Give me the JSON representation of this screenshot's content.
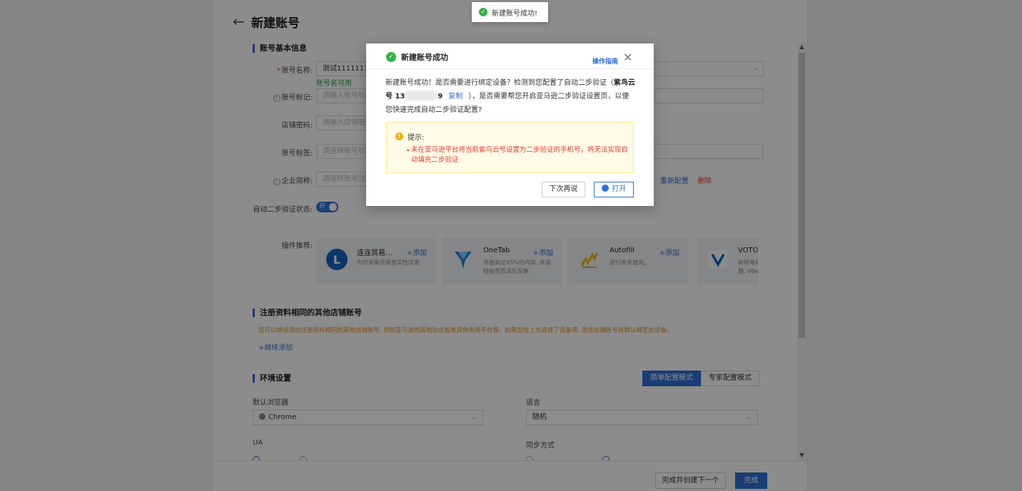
{
  "page": {
    "title": "新建账号",
    "sections": {
      "basic": "账号基本信息",
      "other_accounts": "注册资料相同的其他店铺账号",
      "env": "环境设置"
    },
    "form": {
      "account_name_label": "账号名称:",
      "account_name_value": "测试1111111",
      "account_name_hint": "账号名可用",
      "account_tag_label": "账号标记:",
      "account_tag_placeholder": "请输入账号标记",
      "shop_password_label": "店铺密码:",
      "shop_password_placeholder": "请输入店铺密码",
      "account_label_label": "账号标签:",
      "account_label_placeholder": "请选择账号标签",
      "enterprise_label": "企业简称:",
      "enterprise_placeholder": "请选择账号注册",
      "reconfig": "重新配置",
      "delete": "删除",
      "auto_2fa_label": "自动二步验证状态:",
      "auto_2fa_toggle": "开",
      "plugin_label": "插件推荐:"
    },
    "plugins": [
      {
        "name": "连连贸易...",
        "add": "+添加",
        "desc": "为您采集贸易真实性信息",
        "icon": "lianlian-icon"
      },
      {
        "name": "OneTab",
        "add": "+添加",
        "desc": "节省高达95%的内存, 并减轻标签页混乱现象",
        "icon": "onetab-icon"
      },
      {
        "name": "Autofill",
        "add": "+添加",
        "desc": "进行表单填充。",
        "icon": "autofill-icon"
      },
      {
        "name": "VOTOB",
        "add": "",
        "desc": "跨境电商器, eBa",
        "icon": "votob-icon"
      }
    ],
    "other_accounts_warning": "您可以继续添加注册资料相同的其他店铺账号, 例如亚马逊的其他站点或者其他电商平台等。如果您在上方选择了设备项, 这些店铺账号将默认绑定此设备。",
    "continue_add": "+继续添加",
    "modes": [
      "简单配置模式",
      "专家配置模式"
    ],
    "env": {
      "browser_label": "默认浏览器",
      "browser_value": "Chrome",
      "language_label": "语言",
      "language_value": "随机",
      "ua_label": "UA",
      "sync_label": "同步方式"
    },
    "footer": {
      "create_next": "完成并创建下一个",
      "done": "完成"
    }
  },
  "toast": {
    "text": "新建账号成功!"
  },
  "modal": {
    "title": "新建账号成功",
    "guide": "操作指南",
    "close": "✕",
    "body_1": "新建账号成功！是否需要进行绑定设备？检测到您配置了自动二步验证（",
    "body_bold": "紫鸟云号 13",
    "body_phone_end": "9",
    "copy": "复制",
    "body_2": "），是否需要帮您开启亚马逊二步验证设置页，以便您快速完成自动二步验证配置?",
    "tip_title": "提示:",
    "tip_text": "未在亚马逊平台将当前紫鸟云号设置为二步验证的手机号，将无法实现自动填充二步验证",
    "later": "下次再说",
    "open": "打开"
  },
  "colors": {
    "accent": "#2f6fd6",
    "success": "#35b24a",
    "danger": "#e53935",
    "warning": "#faad14"
  }
}
